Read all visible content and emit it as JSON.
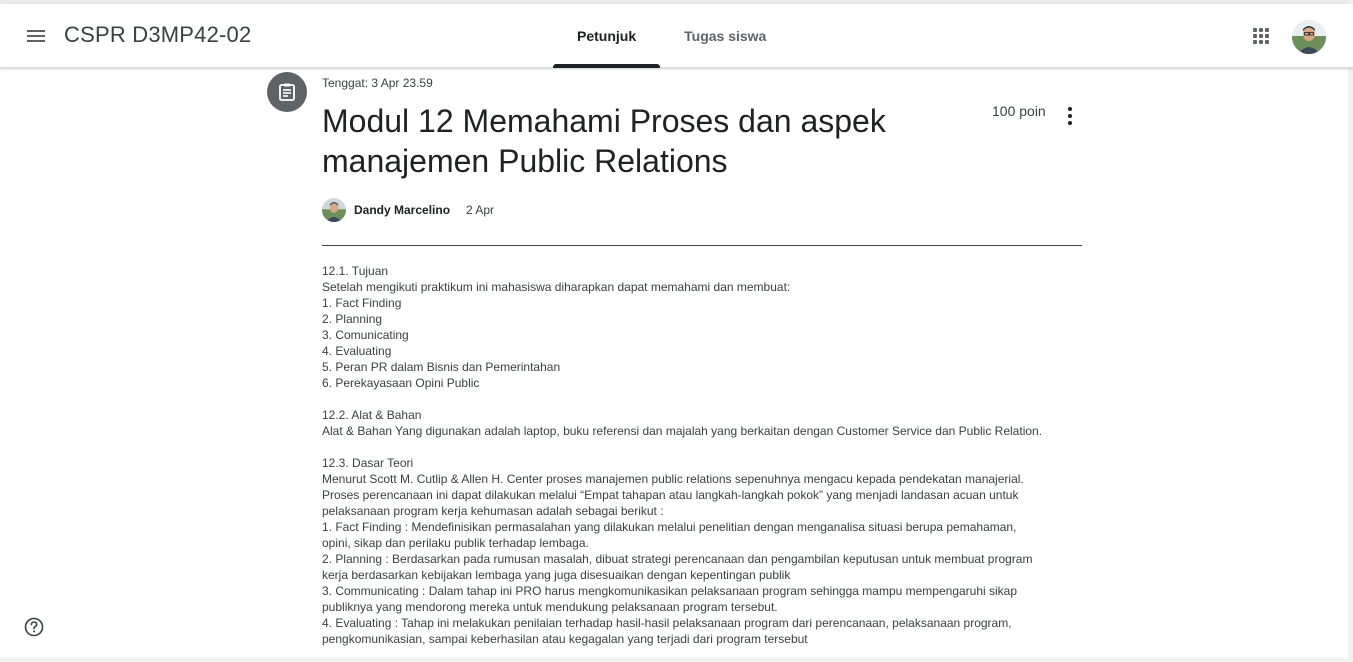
{
  "header": {
    "class_name": "CSPR D3MP42-02",
    "tabs": [
      {
        "label": "Petunjuk",
        "active": true
      },
      {
        "label": "Tugas siswa",
        "active": false
      }
    ],
    "icons": {
      "menu": "hamburger-menu-icon",
      "apps": "google-apps-icon",
      "avatar": "profile-avatar"
    }
  },
  "assignment": {
    "icon": "assignment-clipboard-icon",
    "due": "Tenggat: 3 Apr 23.59",
    "title": "Modul 12 Memahami Proses dan aspek manajemen Public Relations",
    "points": "100 poin",
    "author": "Dandy Marcelino",
    "date": "2 Apr"
  },
  "body_lines": [
    "12.1. Tujuan",
    "Setelah mengikuti praktikum ini mahasiswa diharapkan dapat memahami dan membuat:",
    "1. Fact Finding",
    "2. Planning",
    "3. Comunicating",
    "4. Evaluating",
    "5. Peran PR dalam Bisnis dan Pemerintahan",
    "6. Perekayasaan Opini Public",
    "",
    "12.2. Alat & Bahan",
    "Alat & Bahan Yang digunakan adalah laptop, buku referensi dan majalah yang berkaitan dengan Customer Service dan Public Relation.",
    "",
    "12.3. Dasar Teori",
    "Menurut Scott M. Cutlip & Allen H. Center proses manajemen public relations sepenuhnya mengacu kepada pendekatan manajerial.",
    "Proses perencanaan ini dapat dilakukan melalui “Empat tahapan atau langkah-langkah pokok” yang menjadi landasan acuan untuk",
    "pelaksanaan program kerja kehumasan adalah sebagai berikut :",
    "1. Fact Finding : Mendefinisikan permasalahan yang dilakukan melalui penelitian dengan menganalisa situasi berupa pemahaman,",
    "opini, sikap dan perilaku publik terhadap lembaga.",
    "2. Planning : Berdasarkan pada rumusan masalah, dibuat strategi perencanaan dan pengambilan keputusan untuk membuat program",
    "kerja berdasarkan kebijakan lembaga yang juga disesuaikan dengan kepentingan publik",
    "3. Communicating : Dalam tahap ini PRO harus mengkomunikasikan pelaksanaan program sehingga mampu mempengaruhi sikap",
    "publiknya yang mendorong mereka untuk mendukung pelaksanaan program tersebut.",
    "4. Evaluating : Tahap ini melakukan penilaian terhadap hasil-hasil pelaksanaan program dari perencanaan, pelaksanaan program,",
    "pengkomunikasian, sampai keberhasilan atau kegagalan yang terjadi dari program tersebut"
  ],
  "footer": {
    "help_icon": "help-circle-icon"
  },
  "colors": {
    "text": "#3c4043",
    "title": "#202124",
    "icon_bg": "#5f6368",
    "tab_indicator": "#202124"
  }
}
